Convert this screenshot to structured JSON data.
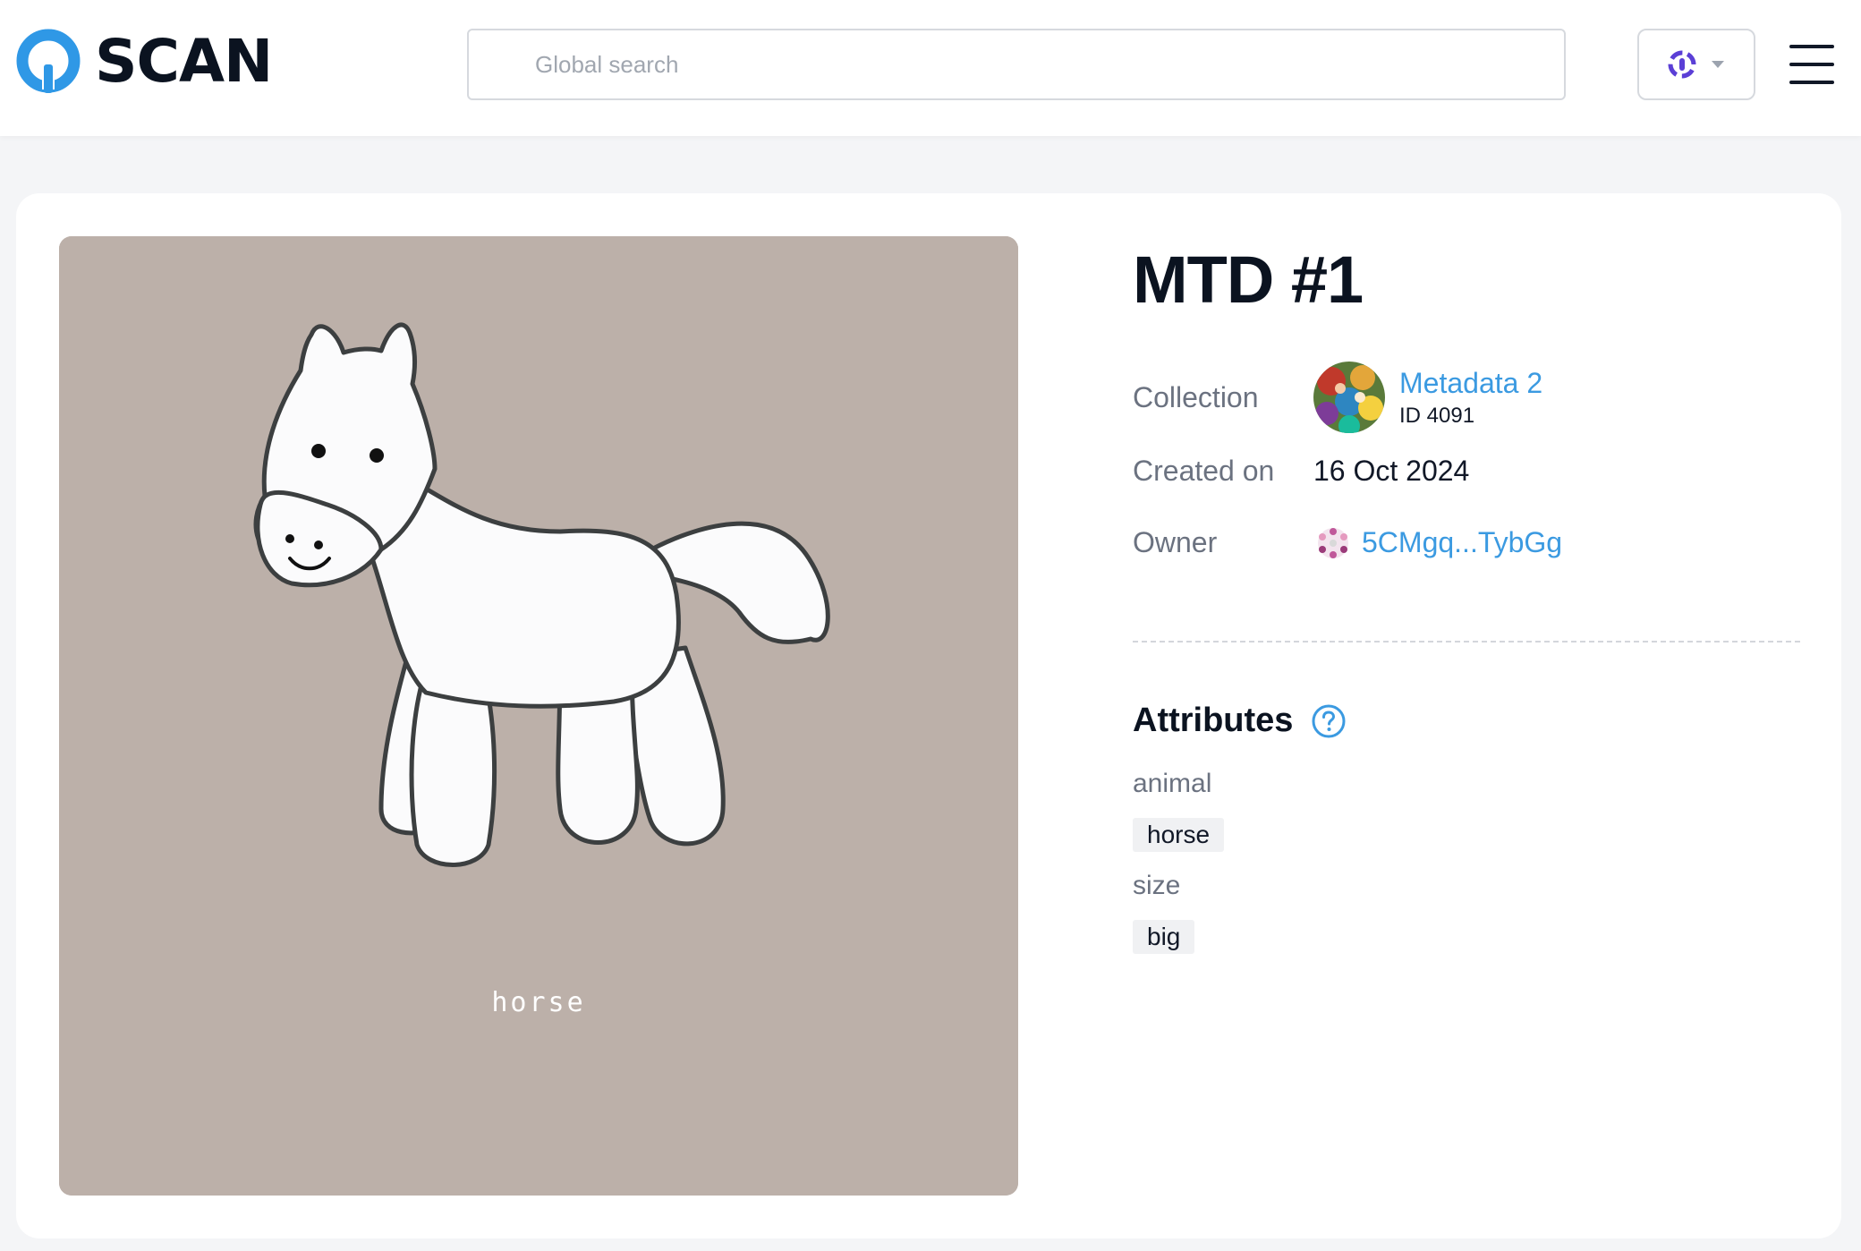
{
  "header": {
    "logo_text": "SCAN",
    "search_placeholder": "Global search",
    "network_icon": "polkadot-icon",
    "menu_icon": "hamburger-icon"
  },
  "nft": {
    "image_caption": "horse",
    "title": "MTD #1",
    "collection_label": "Collection",
    "collection_name": "Metadata 2",
    "collection_id": "ID 4091",
    "created_label": "Created on",
    "created_value": "16 Oct 2024",
    "owner_label": "Owner",
    "owner_value": "5CMgq...TybGg"
  },
  "attributes": {
    "title": "Attributes",
    "items": [
      {
        "key": "animal",
        "value": "horse"
      },
      {
        "key": "size",
        "value": "big"
      }
    ]
  },
  "colors": {
    "accent": "#3b9ae1",
    "network": "#5b3fd6",
    "image_bg": "#bcb0a9"
  }
}
